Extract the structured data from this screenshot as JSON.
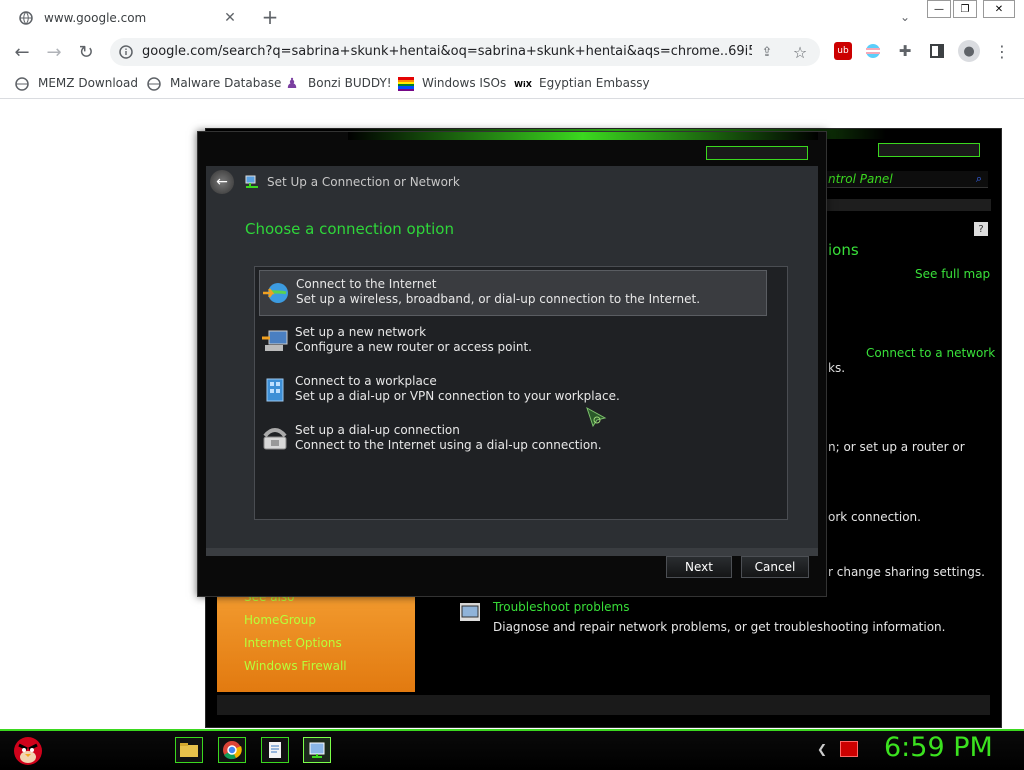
{
  "browser": {
    "tab": {
      "title": "www.google.com"
    },
    "new_tab_label": "+",
    "url": "google.com/search?q=sabrina+skunk+hentai&oq=sabrina+skunk+hentai&aqs=chrome..69i57.4...",
    "bookmarks": [
      {
        "label": "MEMZ Download",
        "icon": "globe-icon"
      },
      {
        "label": "Malware Database",
        "icon": "globe-icon"
      },
      {
        "label": "Bonzi BUDDY!",
        "icon": "bonzi-icon"
      },
      {
        "label": "Windows ISOs",
        "icon": "windows-flag-icon"
      },
      {
        "label": "Egyptian Embassy",
        "icon": "wix-icon"
      }
    ],
    "wix_text": "WiX"
  },
  "control_panel": {
    "search_placeholder": "ntrol Panel",
    "heading_partial": "ions",
    "see_full_map": "See full map",
    "connect_to_network": "Connect to a network",
    "texts": [
      "ks.",
      "n; or set up a router or",
      "ork connection.",
      "r change sharing settings."
    ],
    "troubleshoot": {
      "title": "Troubleshoot problems",
      "desc": "Diagnose and repair network problems, or get troubleshooting information."
    },
    "see_also": {
      "title": "See also",
      "links": [
        "HomeGroup",
        "Internet Options",
        "Windows Firewall"
      ]
    }
  },
  "dialog": {
    "title": "Set Up a Connection or Network",
    "heading": "Choose a connection option",
    "options": [
      {
        "title": "Connect to the Internet",
        "desc": "Set up a wireless, broadband, or dial-up connection to the Internet.",
        "icon": "globe-connect-icon"
      },
      {
        "title": "Set up a new network",
        "desc": "Configure a new router or access point.",
        "icon": "new-network-icon"
      },
      {
        "title": "Connect to a workplace",
        "desc": "Set up a dial-up or VPN connection to your workplace.",
        "icon": "workplace-icon"
      },
      {
        "title": "Set up a dial-up connection",
        "desc": "Connect to the Internet using a dial-up connection.",
        "icon": "dialup-phone-icon"
      }
    ],
    "next_label": "Next",
    "cancel_label": "Cancel"
  },
  "taskbar": {
    "clock": "6:59 PM"
  },
  "colors": {
    "accent_green": "#3be21f",
    "dialog_heading": "#2fd63a",
    "orange": "#f29a2e"
  }
}
